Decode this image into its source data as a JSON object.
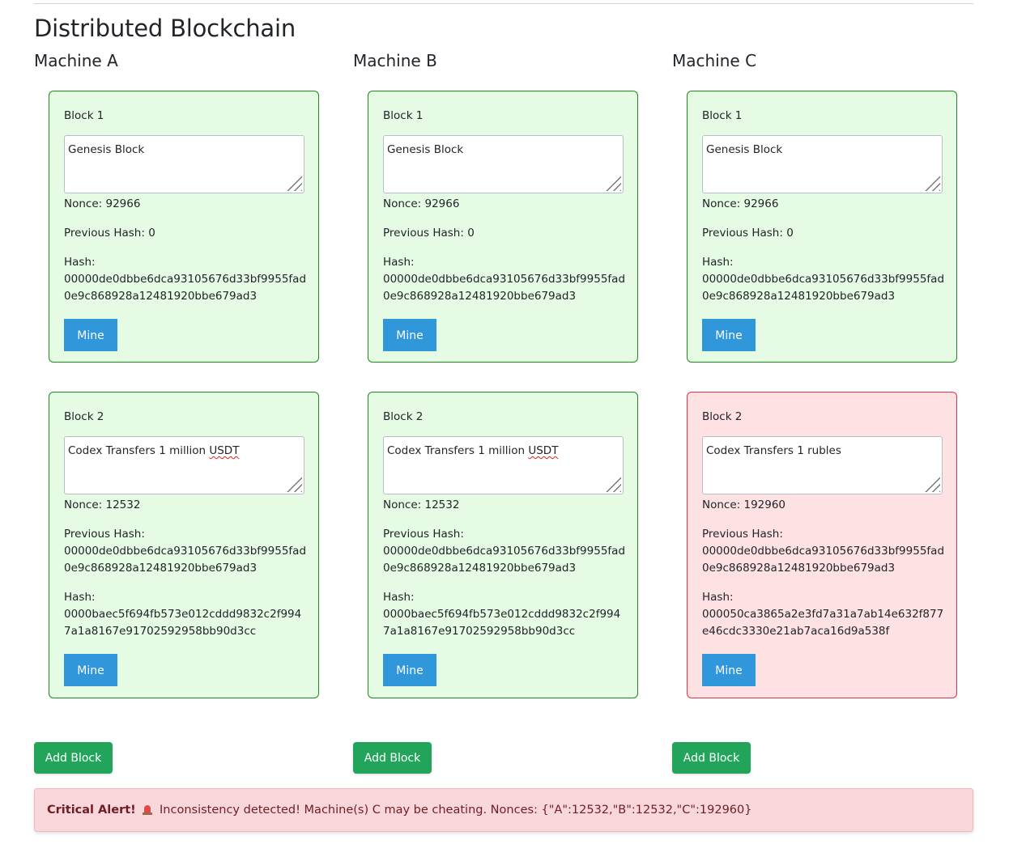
{
  "page_title": "Distributed Blockchain",
  "machines": [
    {
      "title": "Machine A",
      "add_block_label": "Add Block",
      "blocks": [
        {
          "label": "Block 1",
          "data": "Genesis Block",
          "nonce": "Nonce: 92966",
          "prev_label": "Previous Hash: 0",
          "prev_value": "",
          "hash_label": "Hash:",
          "hash_value": "00000de0dbbe6dca93105676d33bf9955fad0e9c868928a12481920bbe679ad3",
          "mine_label": "Mine",
          "valid": true
        },
        {
          "label": "Block 2",
          "data": "Codex Transfers 1 million USDT",
          "nonce": "Nonce: 12532",
          "prev_label": "Previous Hash:",
          "prev_value": "00000de0dbbe6dca93105676d33bf9955fad0e9c868928a12481920bbe679ad3",
          "hash_label": "Hash:",
          "hash_value": "0000baec5f694fb573e012cddd9832c2f9947a1a8167e91702592958bb90d3cc",
          "mine_label": "Mine",
          "valid": true
        }
      ]
    },
    {
      "title": "Machine B",
      "add_block_label": "Add Block",
      "blocks": [
        {
          "label": "Block 1",
          "data": "Genesis Block",
          "nonce": "Nonce: 92966",
          "prev_label": "Previous Hash: 0",
          "prev_value": "",
          "hash_label": "Hash:",
          "hash_value": "00000de0dbbe6dca93105676d33bf9955fad0e9c868928a12481920bbe679ad3",
          "mine_label": "Mine",
          "valid": true
        },
        {
          "label": "Block 2",
          "data": "Codex Transfers 1 million USDT",
          "nonce": "Nonce: 12532",
          "prev_label": "Previous Hash:",
          "prev_value": "00000de0dbbe6dca93105676d33bf9955fad0e9c868928a12481920bbe679ad3",
          "hash_label": "Hash:",
          "hash_value": "0000baec5f694fb573e012cddd9832c2f9947a1a8167e91702592958bb90d3cc",
          "mine_label": "Mine",
          "valid": true
        }
      ]
    },
    {
      "title": "Machine C",
      "add_block_label": "Add Block",
      "blocks": [
        {
          "label": "Block 1",
          "data": "Genesis Block",
          "nonce": "Nonce: 92966",
          "prev_label": "Previous Hash: 0",
          "prev_value": "",
          "hash_label": "Hash:",
          "hash_value": "00000de0dbbe6dca93105676d33bf9955fad0e9c868928a12481920bbe679ad3",
          "mine_label": "Mine",
          "valid": true
        },
        {
          "label": "Block 2",
          "data": "Codex Transfers 1 rubles",
          "nonce": "Nonce: 192960",
          "prev_label": "Previous Hash:",
          "prev_value": "00000de0dbbe6dca93105676d33bf9955fad0e9c868928a12481920bbe679ad3",
          "hash_label": "Hash:",
          "hash_value": "000050ca3865a2e3fd7a31a7ab14e632f877e46cdc3330e21ab7aca16d9a538f",
          "mine_label": "Mine",
          "valid": false
        }
      ]
    }
  ],
  "alert": {
    "title": "Critical Alert!",
    "icon": "siren-icon",
    "message": "Inconsistency detected! Machine(s) C may be cheating. Nonces: {\"A\":12532,\"B\":12532,\"C\":192960}"
  },
  "colors": {
    "valid_bg": "#e5fbe3",
    "valid_border": "#1e8a1e",
    "invalid_bg": "#fde1e3",
    "invalid_border": "#dc3545",
    "mine_button": "#3197db",
    "add_button": "#22a55a",
    "alert_bg": "#f8d7da"
  }
}
